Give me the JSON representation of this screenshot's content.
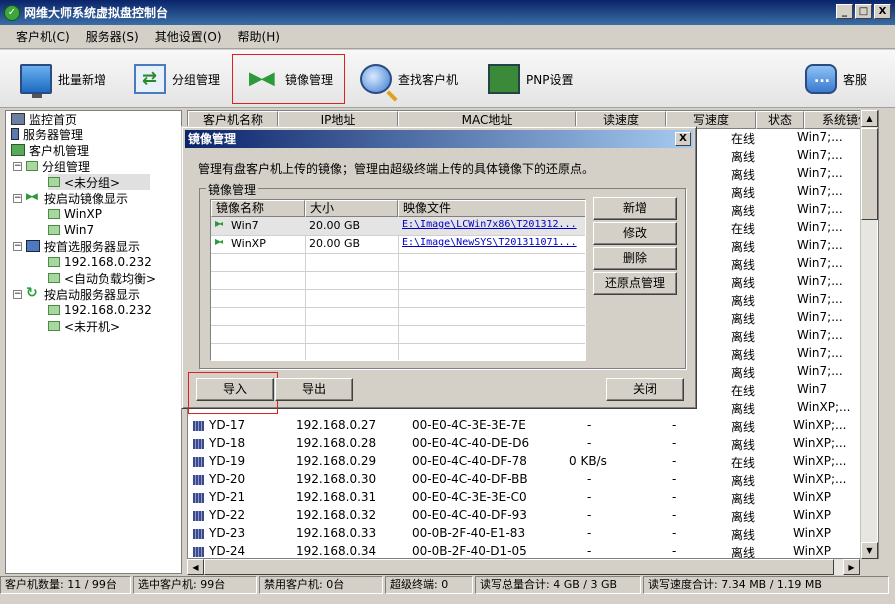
{
  "window": {
    "title": "网维大师系统虚拟盘控制台",
    "min": "_",
    "max": "□",
    "close": "X"
  },
  "menu": [
    "客户机(C)",
    "服务器(S)",
    "其他设置(O)",
    "帮助(H)"
  ],
  "toolbar": {
    "batch_add": "批量新增",
    "group_manage": "分组管理",
    "image_manage": "镜像管理",
    "find_client": "查找客户机",
    "pnp": "PNP设置",
    "service": "客服"
  },
  "tree": {
    "monitor_home": "监控首页",
    "server_manage": "服务器管理",
    "client_manage": "客户机管理",
    "group_manage": "分组管理",
    "ungrouped": "<未分组>",
    "by_boot_image": "按启动镜像显示",
    "win_xp": "WinXP",
    "win_7": "Win7",
    "by_pref_server": "按首选服务器显示",
    "pref_ip": "192.168.0.232",
    "auto_balance": "<自动负载均衡>",
    "by_boot_server": "按启动服务器显示",
    "boot_ip": "192.168.0.232",
    "not_started": "<未开机>"
  },
  "grid": {
    "columns": [
      "客户机名称",
      "IP地址",
      "MAC地址",
      "读速度",
      "写速度",
      "状态",
      "系统镜像"
    ],
    "upper_rows": [
      {
        "status": "在线",
        "image": "Win7;..."
      },
      {
        "status": "离线",
        "image": "Win7;..."
      },
      {
        "status": "离线",
        "image": "Win7;..."
      },
      {
        "status": "离线",
        "image": "Win7;..."
      },
      {
        "status": "离线",
        "image": "Win7;..."
      },
      {
        "status": "在线",
        "image": "Win7;..."
      },
      {
        "status": "离线",
        "image": "Win7;..."
      },
      {
        "status": "离线",
        "image": "Win7;..."
      },
      {
        "status": "离线",
        "image": "Win7;..."
      },
      {
        "status": "离线",
        "image": "Win7;..."
      },
      {
        "status": "离线",
        "image": "Win7;..."
      },
      {
        "status": "离线",
        "image": "Win7;..."
      },
      {
        "status": "离线",
        "image": "Win7;..."
      },
      {
        "status": "离线",
        "image": "Win7;..."
      },
      {
        "status": "在线",
        "image": "Win7"
      },
      {
        "status": "离线",
        "image": "WinXP;..."
      }
    ],
    "rows": [
      {
        "name": "YD-17",
        "ip": "192.168.0.27",
        "mac": "00-E0-4C-3E-3E-7E",
        "read": "-",
        "write": "-",
        "status": "离线",
        "image": "WinXP;..."
      },
      {
        "name": "YD-18",
        "ip": "192.168.0.28",
        "mac": "00-E0-4C-40-DE-D6",
        "read": "-",
        "write": "-",
        "status": "离线",
        "image": "WinXP;..."
      },
      {
        "name": "YD-19",
        "ip": "192.168.0.29",
        "mac": "00-E0-4C-40-DF-78",
        "read": "0 KB/s",
        "write": "-",
        "status": "在线",
        "image": "WinXP;..."
      },
      {
        "name": "YD-20",
        "ip": "192.168.0.30",
        "mac": "00-E0-4C-40-DF-BB",
        "read": "-",
        "write": "-",
        "status": "离线",
        "image": "WinXP;..."
      },
      {
        "name": "YD-21",
        "ip": "192.168.0.31",
        "mac": "00-E0-4C-3E-3E-C0",
        "read": "-",
        "write": "-",
        "status": "离线",
        "image": "WinXP"
      },
      {
        "name": "YD-22",
        "ip": "192.168.0.32",
        "mac": "00-E0-4C-40-DF-93",
        "read": "-",
        "write": "-",
        "status": "离线",
        "image": "WinXP"
      },
      {
        "name": "YD-23",
        "ip": "192.168.0.33",
        "mac": "00-0B-2F-40-E1-83",
        "read": "-",
        "write": "-",
        "status": "离线",
        "image": "WinXP"
      },
      {
        "name": "YD-24",
        "ip": "192.168.0.34",
        "mac": "00-0B-2F-40-D1-05",
        "read": "-",
        "write": "-",
        "status": "离线",
        "image": "WinXP"
      }
    ]
  },
  "statusbar": {
    "client_count": "客户机数量: 11 / 99台",
    "selected_count": "选中客户机: 99台",
    "disabled_count": "禁用客户机: 0台",
    "super_terminal": "超级终端: 0",
    "rw_total": "读写总量合计: 4 GB / 3 GB",
    "rw_speed": "读写速度合计: 7.34 MB / 1.19 MB"
  },
  "dialog": {
    "title": "镜像管理",
    "close": "X",
    "description": "管理有盘客户机上传的镜像；管理由超级终端上传的具体镜像下的还原点。",
    "group_label": "镜像管理",
    "columns": [
      "镜像名称",
      "大小",
      "映像文件"
    ],
    "rows": [
      {
        "name": "Win7",
        "size": "20.00 GB",
        "file": "E:\\Image\\LCWin7x86\\T201312..."
      },
      {
        "name": "WinXP",
        "size": "20.00 GB",
        "file": "E:\\Image\\NewSYS\\T201311071..."
      }
    ],
    "buttons": {
      "add": "新增",
      "edit": "修改",
      "delete": "删除",
      "restore": "还原点管理",
      "import": "导入",
      "export": "导出",
      "close": "关闭"
    }
  }
}
